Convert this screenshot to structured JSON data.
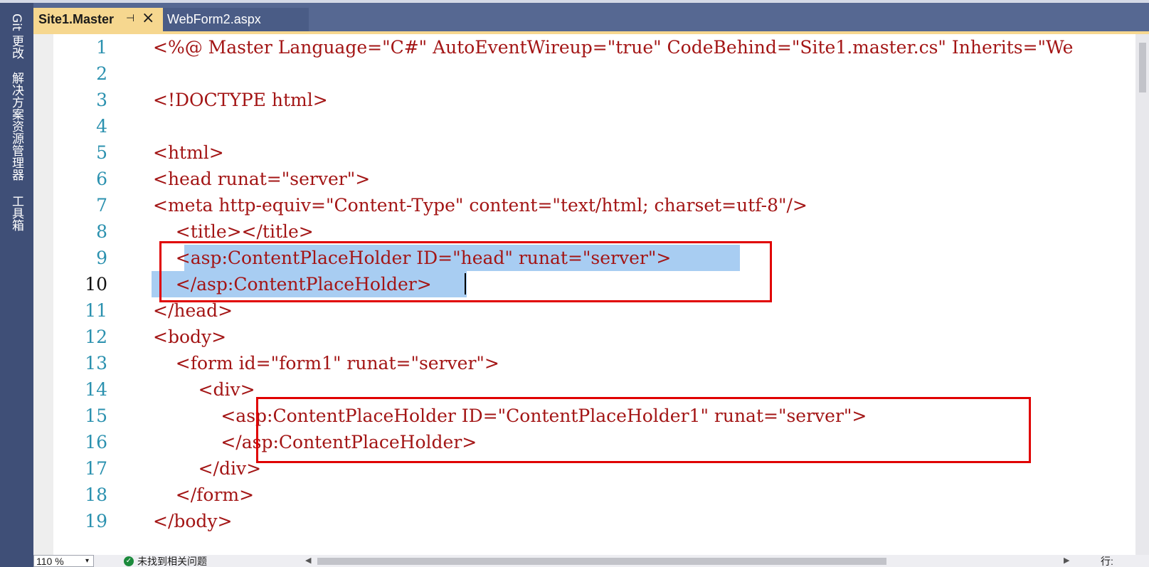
{
  "sidebar": {
    "tabs": [
      {
        "label": "Git 更改"
      },
      {
        "label": "解决方案资源管理器"
      },
      {
        "label": "工具箱"
      }
    ]
  },
  "tabs": {
    "active": {
      "label": "Site1.Master",
      "pin_icon": "pin-icon",
      "close_icon": "close-icon"
    },
    "inactive": {
      "label": "WebForm2.aspx"
    }
  },
  "editor": {
    "current_line": 10,
    "lines": [
      {
        "num": "1",
        "text": "<%@ Master Language=\"C#\" AutoEventWireup=\"true\" CodeBehind=\"Site1.master.cs\" Inherits=\"We"
      },
      {
        "num": "2",
        "text": ""
      },
      {
        "num": "3",
        "text": "<!DOCTYPE html>"
      },
      {
        "num": "4",
        "text": ""
      },
      {
        "num": "5",
        "text": "<html>"
      },
      {
        "num": "6",
        "text": "<head runat=\"server\">"
      },
      {
        "num": "7",
        "text": "<meta http-equiv=\"Content-Type\" content=\"text/html; charset=utf-8\"/>"
      },
      {
        "num": "8",
        "text": "    <title></title>"
      },
      {
        "num": "9",
        "text": "    <asp:ContentPlaceHolder ID=\"head\" runat=\"server\">"
      },
      {
        "num": "10",
        "text": "    </asp:ContentPlaceHolder>"
      },
      {
        "num": "11",
        "text": "</head>"
      },
      {
        "num": "12",
        "text": "<body>"
      },
      {
        "num": "13",
        "text": "    <form id=\"form1\" runat=\"server\">"
      },
      {
        "num": "14",
        "text": "        <div>"
      },
      {
        "num": "15",
        "text": "            <asp:ContentPlaceHolder ID=\"ContentPlaceHolder1\" runat=\"server\">"
      },
      {
        "num": "16",
        "text": "            </asp:ContentPlaceHolder>"
      },
      {
        "num": "17",
        "text": "        </div>"
      },
      {
        "num": "18",
        "text": "    </form>"
      },
      {
        "num": "19",
        "text": "</body>"
      }
    ]
  },
  "statusbar": {
    "zoom": "110 %",
    "issues": "未找到相关问题",
    "check_icon": "check-circle-icon",
    "position_label": "行:"
  },
  "colors": {
    "sidebar_bg": "#3f4f77",
    "tab_bar_bg": "#566892",
    "active_tab_bg": "#f6d78f",
    "line_number": "#2b91af",
    "tag_text": "#a31515",
    "selection": "#a8cdf2",
    "highlight_box": "#e00000"
  }
}
